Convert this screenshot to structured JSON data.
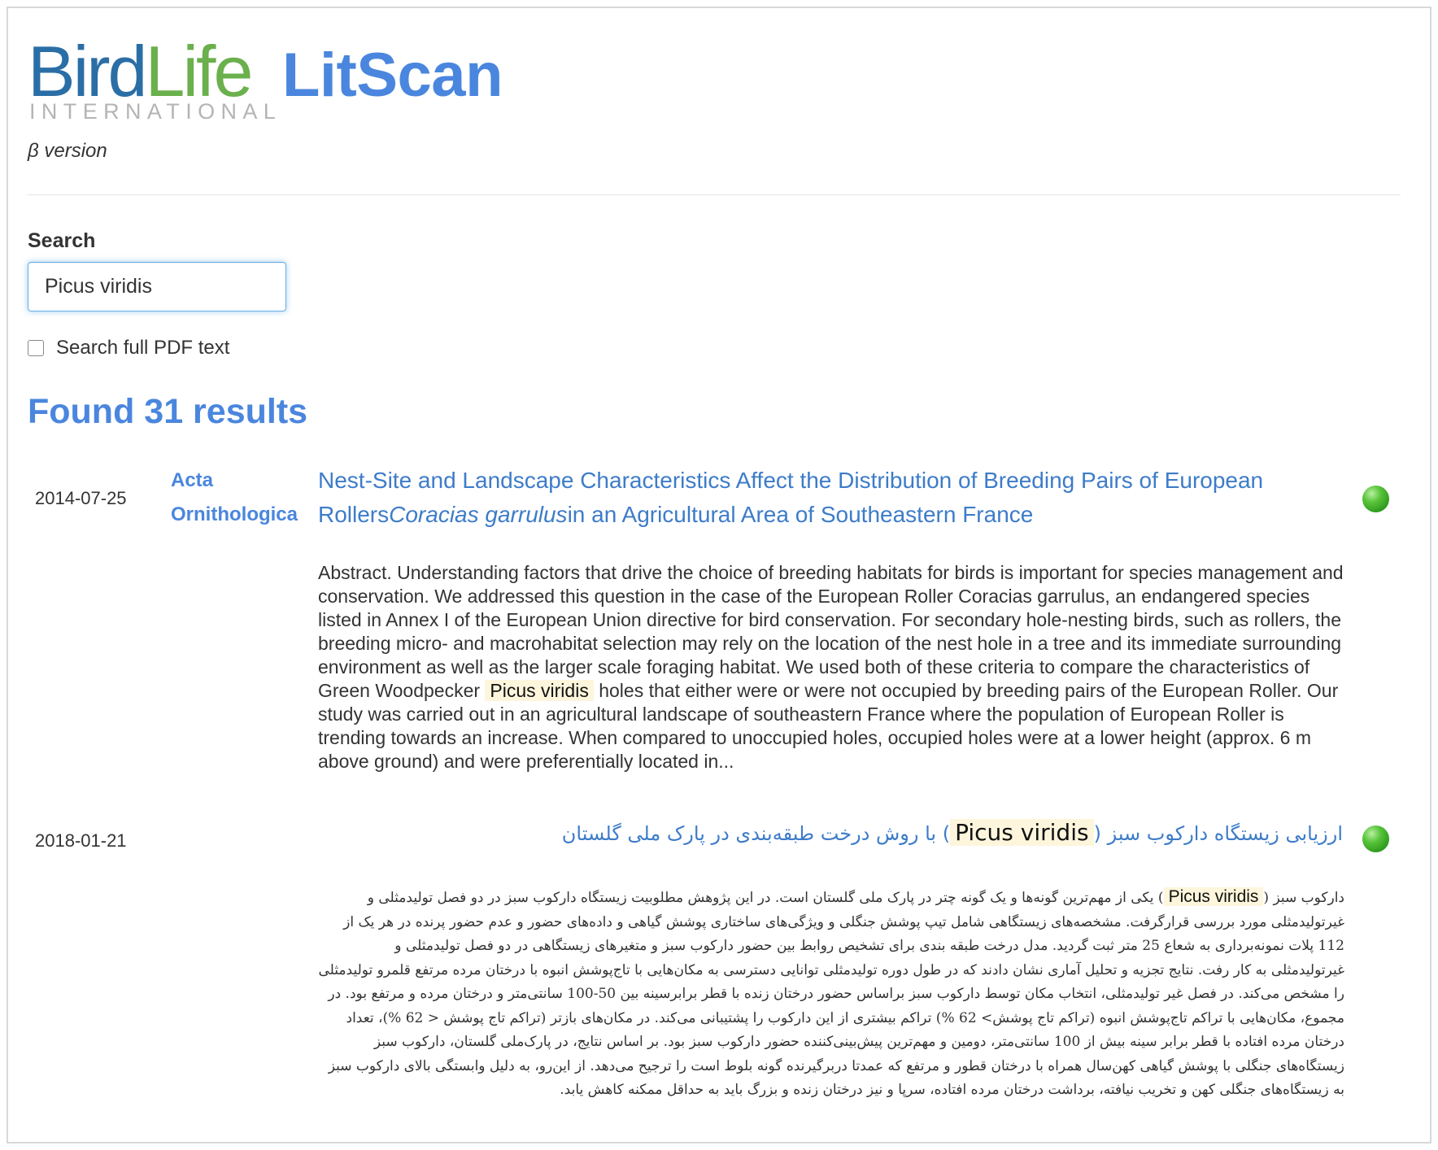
{
  "header": {
    "logo_bird": "Bird",
    "logo_life": "Life",
    "logo_international": "INTERNATIONAL",
    "app_title": "LitScan",
    "version": "β version"
  },
  "search": {
    "label": "Search",
    "value": "Picus viridis",
    "full_pdf_label": "Search full PDF text",
    "full_pdf_checked": false
  },
  "results_summary": "Found 31 results",
  "results": [
    {
      "date": "2014-07-25",
      "journal": "Acta Ornithologica",
      "title_part1": "Nest-Site and Landscape Characteristics Affect the Distribution of Breeding Pairs of European Rollers",
      "title_italic": "Coracias garrulus",
      "title_part2": "in an Agricultural Area of Southeastern France",
      "abstract_before": "Abstract. Understanding factors that drive the choice of breeding habitats for birds is important for species management and conservation. We addressed this question in the case of the European Roller Coracias garrulus, an endangered species listed in Annex I of the European Union directive for bird conservation. For secondary hole-nesting birds, such as rollers, the breeding micro- and macrohabitat selection may rely on the location of the nest hole in a tree and its immediate surrounding environment as well as the larger scale foraging habitat. We used both of these criteria to compare the characteristics of Green Woodpecker",
      "abstract_highlight": "Picus viridis",
      "abstract_after": "holes that either were or were not occupied by breeding pairs of the European Roller. Our study was carried out in an agricultural landscape of southeastern France where the population of European Roller is trending towards an increase. When compared to unoccupied holes, occupied holes were at a lower height (approx. 6 m above ground) and were preferentially located in...",
      "status_color": "#3aa82a"
    },
    {
      "date": "2018-01-21",
      "journal": "",
      "title_before": "ارزیابی زیستگاه دارکوب سبز (",
      "title_highlight": "Picus viridis",
      "title_after": ") با روش درخت طبقه‌بندی در پارک ملی گلستان",
      "abstract_before": "دارکوب سبز (",
      "abstract_highlight": "Picus viridis",
      "abstract_after": ") یکی از مهم‌ترین گونه‌ها و یک گونه چتر در پارک ملی گلستان است. در این پژوهش مطلوبیت زیستگاه دارکوب سبز در دو فصل تولیدمثلی و غیرتولیدمثلی مورد بررسی قرارگرفت. مشخصه‌های زیستگاهی شامل تیپ پوشش جنگلی و ویژگی‌های ساختاری پوشش گیاهی و داده‌های حضور و عدم حضور پرنده در هر یک از 112 پلات نمونه‌برداری به شعاع 25 متر ثبت گردید. مدل درخت طبقه بندی برای تشخیص روابط بین حضور دارکوب سبز و متغیرهای زیستگاهی در دو فصل تولیدمثلی و غیرتولیدمثلی به کار رفت. نتایج تجزیه و تحلیل آماری نشان دادند که در طول دوره تولیدمثلی توانایی دسترسی به مکان‌هایی با تاج‌پوشش انبوه با درختان مرده مرتفع قلمرو تولیدمثلی را مشخص می‌کند. در فصل غیر تولیدمثلی، انتخاب مکان توسط دارکوب سبز براساس حضور درختان زنده با قطر برابرسینه بین 50-100 سانتی‌متر و درختان مرده و مرتفع بود. در مجموع، مکان‌هایی با تراکم تاج‌پوشش انبوه (تراکم تاج پوشش> 62 %) تراکم بیشتری از این دارکوب را پشتیبانی می‌کند. در مکان‌های بازتر (تراکم تاج پوشش < 62 %)، تعداد درختان مرده افتاده با قطر برابر سینه بیش از 100 سانتی‌متر، دومین و مهم‌ترین پیش‌بینی‌کننده حضور دارکوب سبز بود. بر اساس نتایج، در پارک‌ملی گلستان، دارکوب سبز زیستگاه‌های جنگلی با پوشش گیاهی کهن‌سال همراه با درختان قطور و مرتفع که عمدتا دربرگیرنده گونه بلوط است را ترجیح می‌دهد. از این‌رو، به دلیل وابستگی بالای دارکوب سبز به زیستگاه‌های جنگلی کهن و تخریب نیافته، برداشت درختان مرده افتاده، سرپا و نیز درختان زنده و بزرگ باید به حداقل ممکنه کاهش یابد.",
      "status_color": "#3aa82a"
    }
  ],
  "colors": {
    "accent": "#4a86de",
    "link": "#3d7cc9",
    "highlight": "#fdf6dc",
    "bird": "#2a6ea6",
    "life": "#6ab04c"
  }
}
